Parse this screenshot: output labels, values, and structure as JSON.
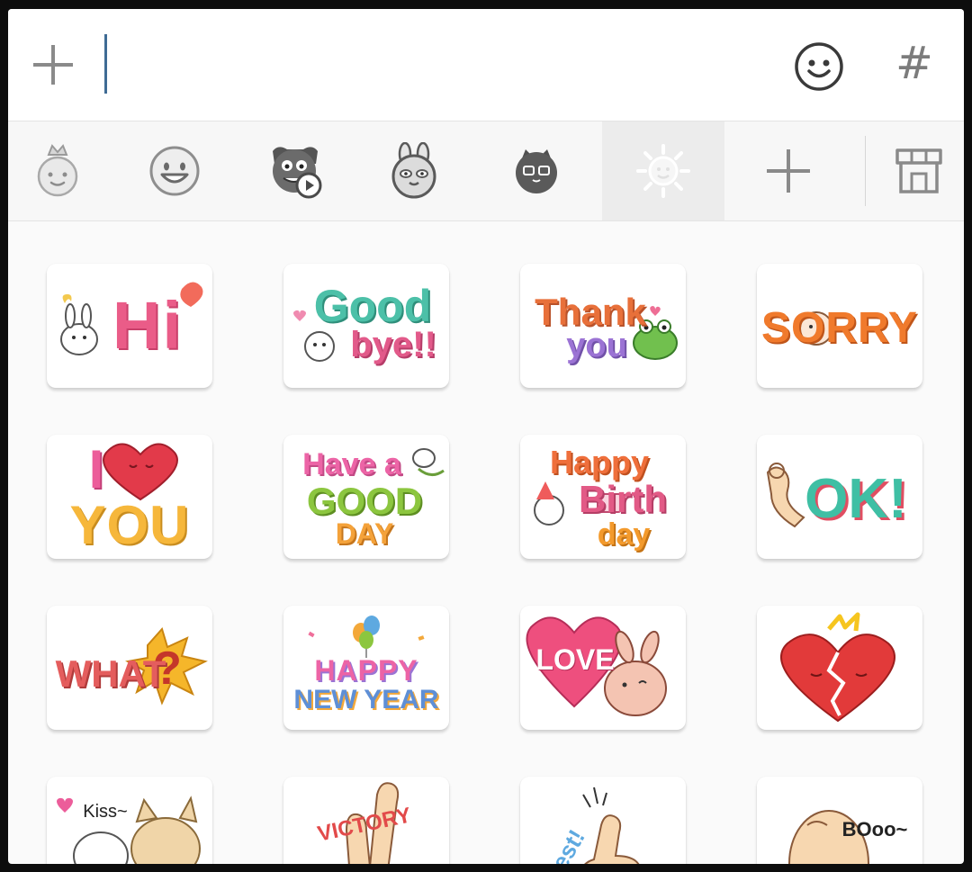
{
  "composer": {
    "attach_icon": "plus-icon",
    "emoticon_icon": "smiley-icon",
    "hashtag_label": "#"
  },
  "tabs": [
    {
      "icon": "crown-face-icon"
    },
    {
      "icon": "smiley-face-icon"
    },
    {
      "icon": "animated-character-icon"
    },
    {
      "icon": "rabbit-face-icon"
    },
    {
      "icon": "cat-face-icon"
    },
    {
      "icon": "sun-icon",
      "active": true
    },
    {
      "icon": "add-icon"
    },
    {
      "icon": "store-icon"
    }
  ],
  "stickers": [
    {
      "name": "hi",
      "text": "Hi"
    },
    {
      "name": "good-bye",
      "text": "Good",
      "text2": "bye!!"
    },
    {
      "name": "thank-you",
      "text": "Thank",
      "text2": "you"
    },
    {
      "name": "sorry",
      "text": "SORRY"
    },
    {
      "name": "i-love-you",
      "text": "I",
      "text2": "YOU"
    },
    {
      "name": "have-a-good-day",
      "text": "Have a",
      "text2": "GOOD",
      "text3": "DAY"
    },
    {
      "name": "happy-birthday",
      "text": "Happy",
      "text2": "Birth",
      "text3": "day"
    },
    {
      "name": "ok",
      "text": "OK!"
    },
    {
      "name": "what",
      "text": "WHAT",
      "text2": "?"
    },
    {
      "name": "happy-new-year",
      "text": "HAPPY",
      "text2": "NEW YEAR"
    },
    {
      "name": "love",
      "text": "LOVE"
    },
    {
      "name": "broken-heart",
      "text": ""
    },
    {
      "name": "kiss",
      "text": "Kiss~"
    },
    {
      "name": "victory",
      "text": "VICTORY"
    },
    {
      "name": "best",
      "text": "Best!"
    },
    {
      "name": "booo",
      "text": "BOoo~"
    }
  ]
}
